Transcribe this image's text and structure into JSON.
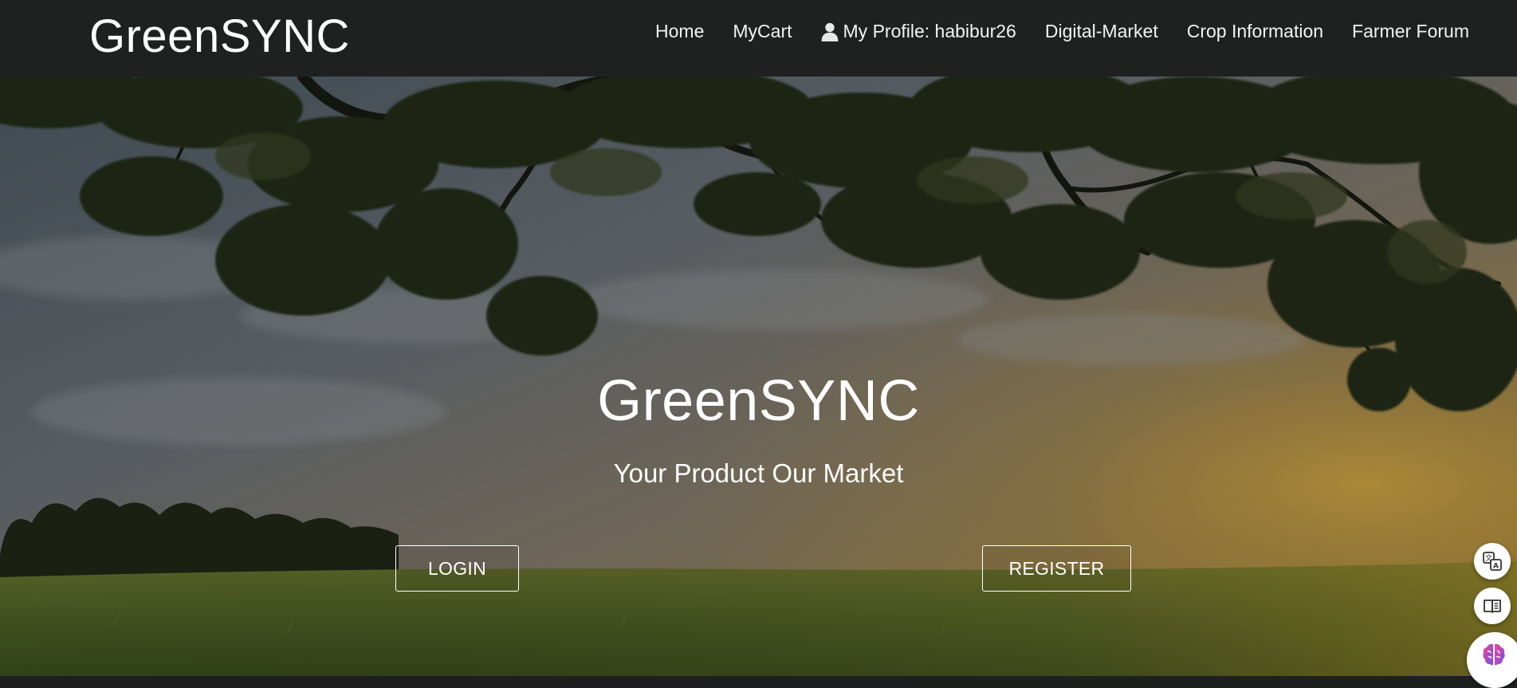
{
  "header": {
    "brand": "GreenSYNC",
    "nav": [
      {
        "label": "Home"
      },
      {
        "label": "MyCart"
      },
      {
        "label": "My Profile: habibur26",
        "icon": "user-icon"
      },
      {
        "label": "Digital-Market"
      },
      {
        "label": "Crop Information"
      },
      {
        "label": "Farmer Forum"
      }
    ]
  },
  "hero": {
    "title": "GreenSYNC",
    "subtitle": "Your Product Our Market",
    "login_label": "LOGIN",
    "register_label": "REGISTER"
  },
  "widgets": {
    "translate_icon": "translate-icon",
    "reader_icon": "book-reader-icon",
    "ai_icon": "ai-brain-icon"
  },
  "colors": {
    "navbar": "#1f2121",
    "text": "#ffffff"
  }
}
